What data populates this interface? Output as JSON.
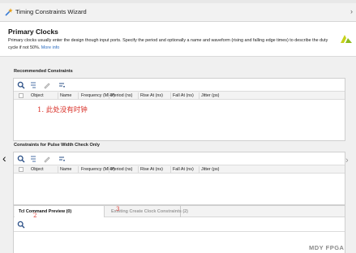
{
  "window": {
    "title": "Timing Constraints Wizard",
    "icon": "wizard-wand-icon"
  },
  "header": {
    "title": "Primary Clocks",
    "description": "Primary clocks usually enter the design though input ports. Specify the period and optionally a name and waveform (rising and falling edge times) to describe the duty cycle if not 50%.",
    "more_info": "More info",
    "logo": "vivado-logo-icon"
  },
  "recommended": {
    "title": "Recommended Constraints",
    "columns": [
      "Object",
      "Name",
      "Frequency (MHz)",
      "Period (ns)",
      "Rise At (ns)",
      "Fall At (ns)",
      "Jitter (ps)"
    ],
    "annotation": "1. 此处没有时钟"
  },
  "pulse_width": {
    "title": "Constraints for Pulse Width Check Only",
    "columns": [
      "Object",
      "Name",
      "Frequency (MHz)",
      "Period (ns)",
      "Rise At (ns)",
      "Fall At (ns)",
      "Jitter (ps)"
    ]
  },
  "toolbar_icons": [
    "search-icon",
    "collapse-icon",
    "edit-icon",
    "sort-icon"
  ],
  "tabs": [
    {
      "label": "Tcl Command Preview (0)",
      "active": true
    },
    {
      "label": "Existing Create Clock Constraints (2)",
      "active": false
    }
  ],
  "annotations": {
    "marker_2": "2",
    "marker_3": "3"
  },
  "watermark": "MDY FPGA",
  "colors": {
    "accent_red": "#d9322a",
    "link_blue": "#2a6bbf",
    "panel_bg": "#f0f0f0"
  }
}
